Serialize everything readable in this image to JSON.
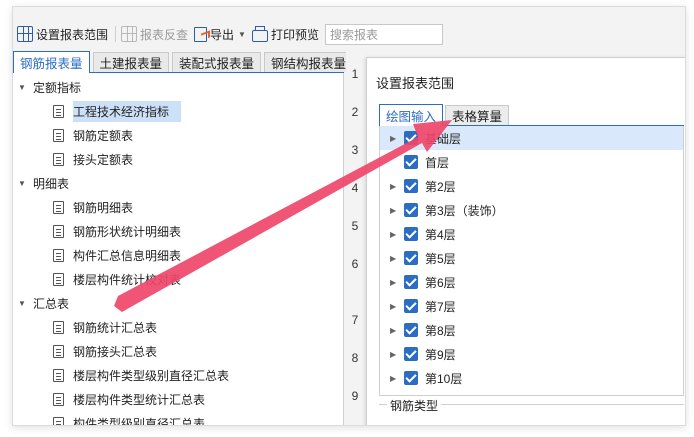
{
  "toolbar": {
    "set_range_label": "设置报表范围",
    "reverse_check_label": "报表反查",
    "export_label": "导出",
    "print_preview_label": "打印预览",
    "search_placeholder": "搜索报表"
  },
  "left_tabs": [
    {
      "label": "钢筋报表量",
      "active": true
    },
    {
      "label": "土建报表量",
      "active": false
    },
    {
      "label": "装配式报表量",
      "active": false
    },
    {
      "label": "钢结构报表量",
      "active": false
    }
  ],
  "tree": {
    "groups": [
      {
        "label": "定额指标",
        "items": [
          "工程技术经济指标",
          "钢筋定额表",
          "接头定额表"
        ]
      },
      {
        "label": "明细表",
        "items": [
          "钢筋明细表",
          "钢筋形状统计明细表",
          "构件汇总信息明细表",
          "楼层构件统计校对表"
        ]
      },
      {
        "label": "汇总表",
        "items": [
          "钢筋统计汇总表",
          "钢筋接头汇总表",
          "楼层构件类型级别直径汇总表",
          "楼层构件类型统计汇总表",
          "构件类型级别直径汇总表"
        ]
      }
    ],
    "selected_item": "工程技术经济指标"
  },
  "row_numbers": [
    "1",
    "2",
    "3",
    "4",
    "5",
    "6",
    "7",
    "8",
    "9"
  ],
  "dialog": {
    "title": "设置报表范围",
    "tabs": [
      {
        "label": "绘图输入",
        "active": true
      },
      {
        "label": "表格算量",
        "active": false
      }
    ],
    "floors": [
      "基础层",
      "首层",
      "第2层",
      "第3层（装饰）",
      "第4层",
      "第5层",
      "第6层",
      "第7层",
      "第8层",
      "第9层",
      "第10层"
    ],
    "rebar_type_label": "钢筋类型"
  },
  "colors": {
    "accent": "#2b6cc4",
    "selection": "#cce0f7",
    "annotation_arrow": "#f0476a"
  }
}
